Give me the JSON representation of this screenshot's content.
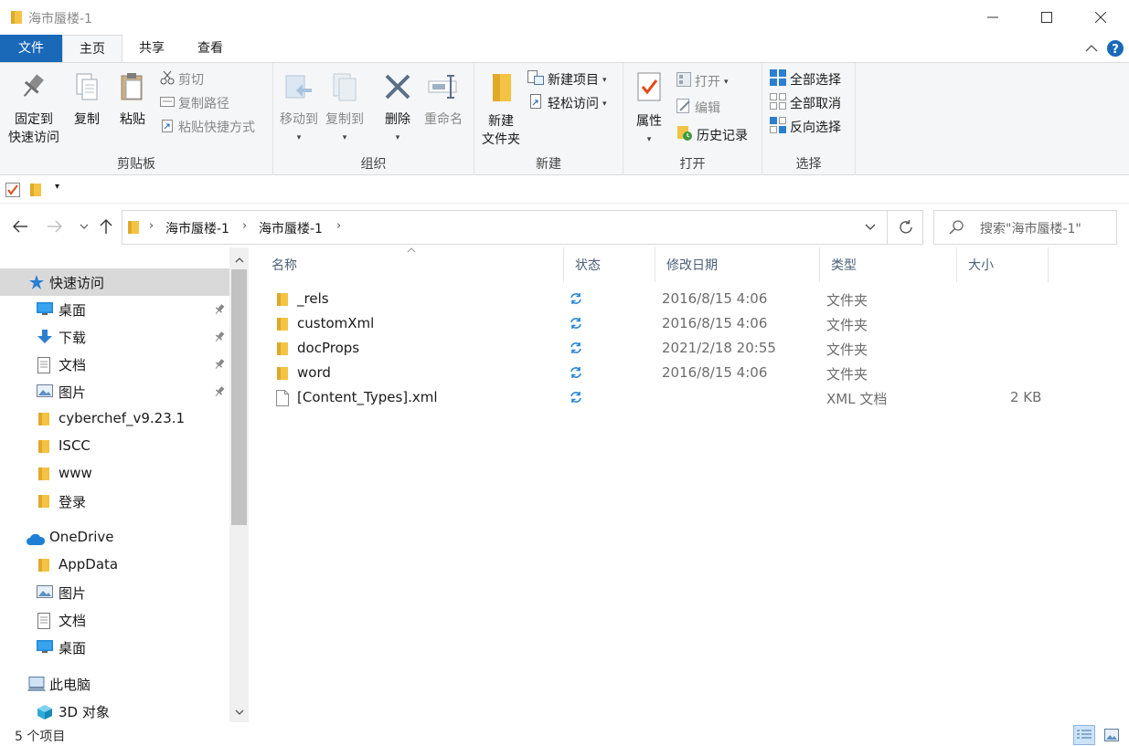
{
  "window": {
    "title": "海市蜃楼-1"
  },
  "ribbon_tabs": {
    "file": "文件",
    "home": "主页",
    "share": "共享",
    "view": "查看"
  },
  "ribbon": {
    "clipboard": {
      "group_label": "剪贴板",
      "pin_line1": "固定到",
      "pin_line2": "快速访问",
      "copy": "复制",
      "paste": "粘贴",
      "cut": "剪切",
      "copy_path": "复制路径",
      "paste_shortcut": "粘贴快捷方式"
    },
    "organize": {
      "group_label": "组织",
      "move_to": "移动到",
      "copy_to": "复制到",
      "delete": "删除",
      "rename": "重命名"
    },
    "new": {
      "group_label": "新建",
      "new_folder_line1": "新建",
      "new_folder_line2": "文件夹",
      "new_item": "新建项目",
      "easy_access": "轻松访问"
    },
    "open": {
      "group_label": "打开",
      "properties": "属性",
      "open": "打开",
      "edit": "编辑",
      "history": "历史记录"
    },
    "select": {
      "group_label": "选择",
      "select_all": "全部选择",
      "select_none": "全部取消",
      "invert": "反向选择"
    }
  },
  "address": {
    "crumbs": [
      "海市蜃楼-1",
      "海市蜃楼-1"
    ]
  },
  "search": {
    "placeholder": "搜索\"海市蜃楼-1\""
  },
  "nav": {
    "quick_access": "快速访问",
    "quick_items": [
      {
        "label": "桌面",
        "icon": "desktop-icon",
        "pinned": true
      },
      {
        "label": "下载",
        "icon": "download-icon",
        "pinned": true
      },
      {
        "label": "文档",
        "icon": "document-icon",
        "pinned": true
      },
      {
        "label": "图片",
        "icon": "picture-icon",
        "pinned": true
      },
      {
        "label": "cyberchef_v9.23.1",
        "icon": "folder-icon",
        "pinned": false
      },
      {
        "label": "ISCC",
        "icon": "folder-icon",
        "pinned": false
      },
      {
        "label": "www",
        "icon": "folder-icon",
        "pinned": false
      },
      {
        "label": "登录",
        "icon": "folder-icon",
        "pinned": false
      }
    ],
    "onedrive": "OneDrive",
    "onedrive_items": [
      {
        "label": "AppData",
        "icon": "folder-icon"
      },
      {
        "label": "图片",
        "icon": "picture-icon"
      },
      {
        "label": "文档",
        "icon": "document-icon"
      },
      {
        "label": "桌面",
        "icon": "desktop-icon"
      }
    ],
    "this_pc": "此电脑",
    "objects_3d": "3D 对象"
  },
  "columns": {
    "name": "名称",
    "status": "状态",
    "modified": "修改日期",
    "type": "类型",
    "size": "大小"
  },
  "files": [
    {
      "name": "_rels",
      "kind": "folder",
      "modified": "2016/8/15 4:06",
      "type": "文件夹",
      "size": ""
    },
    {
      "name": "customXml",
      "kind": "folder",
      "modified": "2016/8/15 4:06",
      "type": "文件夹",
      "size": ""
    },
    {
      "name": "docProps",
      "kind": "folder",
      "modified": "2021/2/18 20:55",
      "type": "文件夹",
      "size": ""
    },
    {
      "name": "word",
      "kind": "folder",
      "modified": "2016/8/15 4:06",
      "type": "文件夹",
      "size": ""
    },
    {
      "name": "[Content_Types].xml",
      "kind": "file",
      "modified": "",
      "type": "XML 文档",
      "size": "2 KB"
    }
  ],
  "status_bar": {
    "count": "5 个项目"
  },
  "colors": {
    "accent": "#1a68b8",
    "folder": "#f4c343",
    "sync": "#1e7fd4",
    "selection": "#d9d9d9"
  }
}
